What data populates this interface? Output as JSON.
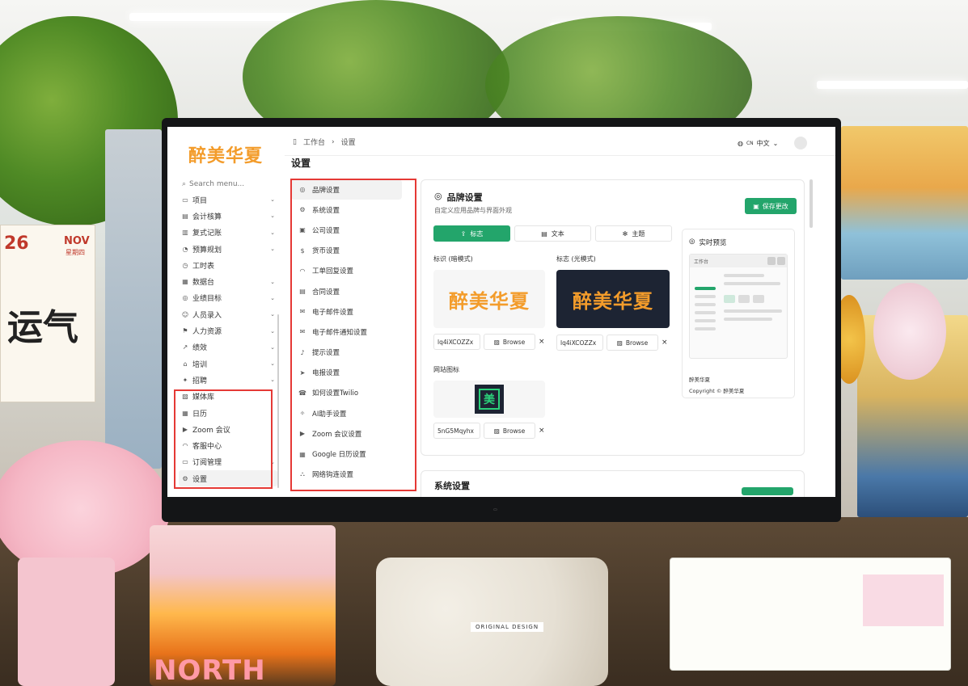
{
  "app": {
    "brand": "醉美华夏",
    "breadcrumb": [
      "工作台",
      "设置"
    ],
    "language": {
      "code": "CN",
      "label": "中文"
    },
    "page_title": "设置"
  },
  "search": {
    "placeholder": "Search menu..."
  },
  "sidebar": {
    "items": [
      {
        "label": "项目",
        "icon": "folder-icon",
        "expandable": true
      },
      {
        "label": "会计核算",
        "icon": "ledger-icon",
        "expandable": true
      },
      {
        "label": "复式记账",
        "icon": "book-icon",
        "expandable": true
      },
      {
        "label": "预算规划",
        "icon": "budget-icon",
        "expandable": true
      },
      {
        "label": "工时表",
        "icon": "clock-icon",
        "expandable": false
      },
      {
        "label": "数据台",
        "icon": "database-icon",
        "expandable": true
      },
      {
        "label": "业绩目标",
        "icon": "target-icon",
        "expandable": true
      },
      {
        "label": "人员录入",
        "icon": "users-icon",
        "expandable": true
      },
      {
        "label": "人力资源",
        "icon": "hr-icon",
        "expandable": true
      },
      {
        "label": "绩效",
        "icon": "trend-icon",
        "expandable": true
      },
      {
        "label": "培训",
        "icon": "graduation-icon",
        "expandable": true
      },
      {
        "label": "招聘",
        "icon": "recruit-icon",
        "expandable": true
      },
      {
        "label": "媒体库",
        "icon": "image-icon",
        "expandable": false
      },
      {
        "label": "日历",
        "icon": "calendar-icon",
        "expandable": false
      },
      {
        "label": "Zoom 会议",
        "icon": "video-icon",
        "expandable": false
      },
      {
        "label": "客服中心",
        "icon": "headset-icon",
        "expandable": false
      },
      {
        "label": "订阅管理",
        "icon": "subscription-icon",
        "expandable": true
      },
      {
        "label": "设置",
        "icon": "gear-icon",
        "expandable": false,
        "active": true
      }
    ]
  },
  "settings_menu": {
    "items": [
      {
        "label": "品牌设置",
        "icon": "palette-icon",
        "active": true
      },
      {
        "label": "系统设置",
        "icon": "gear-icon"
      },
      {
        "label": "公司设置",
        "icon": "building-icon"
      },
      {
        "label": "货币设置",
        "icon": "dollar-icon"
      },
      {
        "label": "工单回复设置",
        "icon": "headset-icon"
      },
      {
        "label": "合同设置",
        "icon": "contract-icon"
      },
      {
        "label": "电子邮件设置",
        "icon": "mail-icon"
      },
      {
        "label": "电子邮件通知设置",
        "icon": "mail-bell-icon"
      },
      {
        "label": "提示设置",
        "icon": "bell-icon"
      },
      {
        "label": "电报设置",
        "icon": "telegram-icon"
      },
      {
        "label": "如何设置Twilio",
        "icon": "phone-icon"
      },
      {
        "label": "AI助手设置",
        "icon": "ai-icon"
      },
      {
        "label": "Zoom 会议设置",
        "icon": "video-icon"
      },
      {
        "label": "Google 日历设置",
        "icon": "google-calendar-icon"
      },
      {
        "label": "网络钩连设置",
        "icon": "webhook-icon"
      }
    ]
  },
  "brand_settings": {
    "title": "品牌设置",
    "subtitle": "自定义应用品牌与界面外观",
    "save_label": "保存更改",
    "tabs": [
      {
        "label": "标志",
        "icon": "upload-icon",
        "active": true
      },
      {
        "label": "文本",
        "icon": "document-icon"
      },
      {
        "label": "主题",
        "icon": "theme-icon"
      }
    ],
    "logo_dark_label": "标识 (暗模式)",
    "logo_light_label": "标志 (光模式)",
    "logo_text": "醉美华夏",
    "logo_dark_file": "lq4iXCOZZx",
    "logo_light_file": "lq4iXCOZZx",
    "favicon_label": "网站图标",
    "favicon_glyph": "美",
    "favicon_file": "5nG5Mqyhx",
    "browse_label": "Browse",
    "preview": {
      "title": "实时预览",
      "mini_header": "工作台",
      "footer_name": "醉美华夏",
      "footer_copy": "Copyright © 醉美华夏"
    }
  },
  "system_settings_card": {
    "title": "系统设置"
  },
  "colors": {
    "accent": "#23a56b",
    "brand_orange": "#f39c2b",
    "highlight_red": "#e53935",
    "dark_logo_bg": "#1d2433"
  },
  "scene": {
    "calendar_day": "26",
    "calendar_month": "NOV",
    "calendar_weekday": "星期四",
    "calendar_big": "运气",
    "lamp_text": "NORTH",
    "tissue_tag": "ORIGINAL DESIGN"
  }
}
